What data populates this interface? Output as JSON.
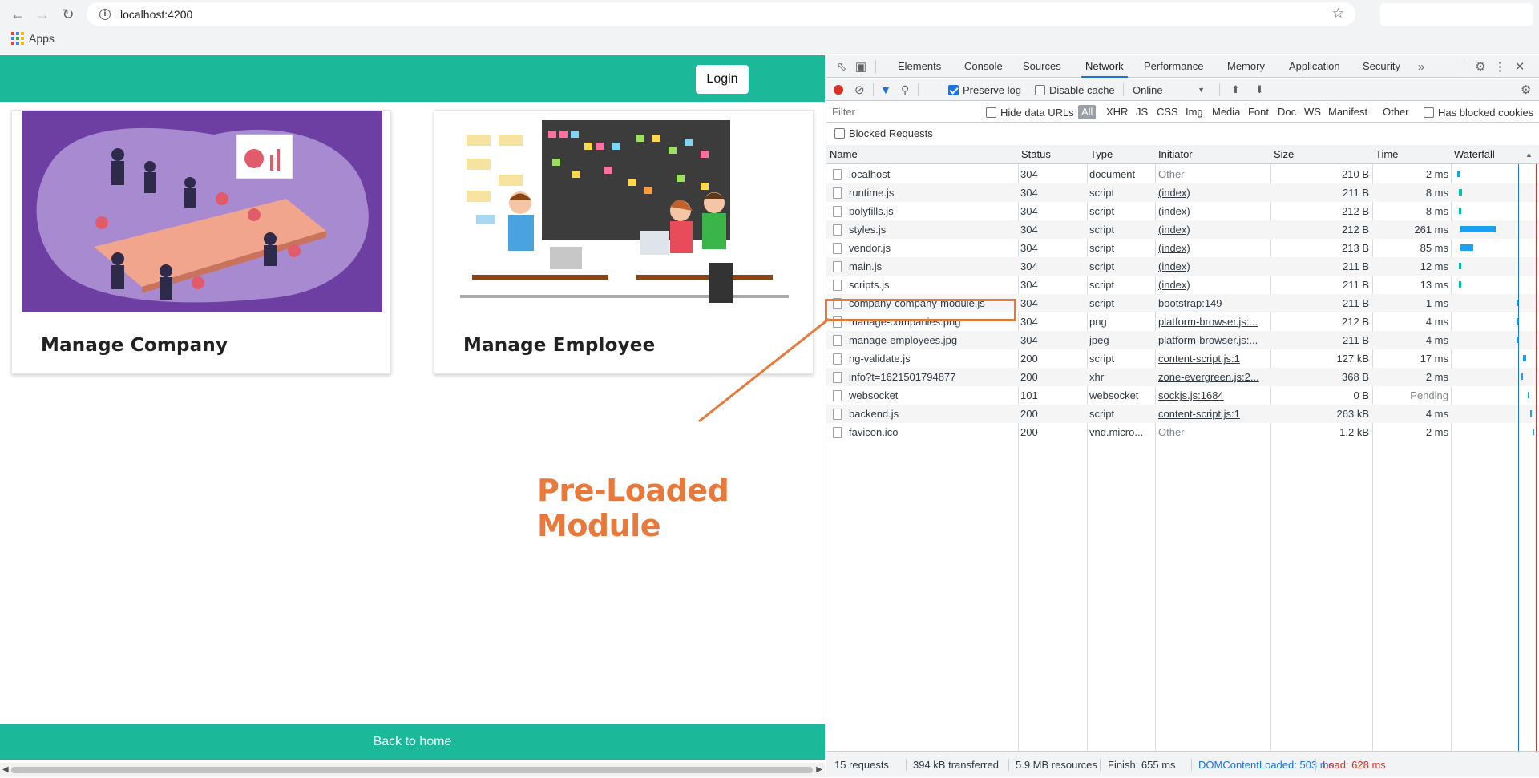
{
  "browser": {
    "url": "localhost:4200",
    "bookmark_apps": "Apps"
  },
  "app": {
    "login_label": "Login",
    "cards": [
      {
        "title": "Manage Company"
      },
      {
        "title": "Manage Employee"
      }
    ],
    "footer_label": "Back to home",
    "annotation": "Pre-Loaded Module",
    "colors": {
      "accent": "#1bb99a",
      "annotation": "#e8793b"
    }
  },
  "devtools": {
    "tabs": [
      "Elements",
      "Console",
      "Sources",
      "Network",
      "Performance",
      "Memory",
      "Application",
      "Security"
    ],
    "active_tab": "Network",
    "toolbar": {
      "preserve_log": "Preserve log",
      "disable_cache": "Disable cache",
      "throttle": "Online"
    },
    "filter": {
      "placeholder": "Filter",
      "hide_data_urls": "Hide data URLs",
      "types": [
        "All",
        "XHR",
        "JS",
        "CSS",
        "Img",
        "Media",
        "Font",
        "Doc",
        "WS",
        "Manifest",
        "Other"
      ],
      "has_blocked_cookies": "Has blocked cookies",
      "blocked_requests": "Blocked Requests"
    },
    "columns": [
      "Name",
      "Status",
      "Type",
      "Initiator",
      "Size",
      "Time",
      "Waterfall"
    ],
    "requests": [
      {
        "name": "localhost",
        "status": "304",
        "type": "document",
        "initiator": "Other",
        "init_link": false,
        "size": "210 B",
        "time": "2 ms"
      },
      {
        "name": "runtime.js",
        "status": "304",
        "type": "script",
        "initiator": "(index)",
        "init_link": true,
        "size": "211 B",
        "time": "8 ms"
      },
      {
        "name": "polyfills.js",
        "status": "304",
        "type": "script",
        "initiator": "(index)",
        "init_link": true,
        "size": "212 B",
        "time": "8 ms"
      },
      {
        "name": "styles.js",
        "status": "304",
        "type": "script",
        "initiator": "(index)",
        "init_link": true,
        "size": "212 B",
        "time": "261 ms"
      },
      {
        "name": "vendor.js",
        "status": "304",
        "type": "script",
        "initiator": "(index)",
        "init_link": true,
        "size": "213 B",
        "time": "85 ms"
      },
      {
        "name": "main.js",
        "status": "304",
        "type": "script",
        "initiator": "(index)",
        "init_link": true,
        "size": "211 B",
        "time": "12 ms"
      },
      {
        "name": "scripts.js",
        "status": "304",
        "type": "script",
        "initiator": "(index)",
        "init_link": true,
        "size": "211 B",
        "time": "13 ms"
      },
      {
        "name": "company-company-module.js",
        "status": "304",
        "type": "script",
        "initiator": "bootstrap:149",
        "init_link": true,
        "size": "211 B",
        "time": "1 ms"
      },
      {
        "name": "manage-companies.png",
        "status": "304",
        "type": "png",
        "initiator": "platform-browser.js:...",
        "init_link": true,
        "size": "212 B",
        "time": "4 ms"
      },
      {
        "name": "manage-employees.jpg",
        "status": "304",
        "type": "jpeg",
        "initiator": "platform-browser.js:...",
        "init_link": true,
        "size": "211 B",
        "time": "4 ms"
      },
      {
        "name": "ng-validate.js",
        "status": "200",
        "type": "script",
        "initiator": "content-script.js:1",
        "init_link": true,
        "size": "127 kB",
        "time": "17 ms"
      },
      {
        "name": "info?t=1621501794877",
        "status": "200",
        "type": "xhr",
        "initiator": "zone-evergreen.js:2...",
        "init_link": true,
        "size": "368 B",
        "time": "2 ms"
      },
      {
        "name": "websocket",
        "status": "101",
        "type": "websocket",
        "initiator": "sockjs.js:1684",
        "init_link": true,
        "size": "0 B",
        "time": "Pending"
      },
      {
        "name": "backend.js",
        "status": "200",
        "type": "script",
        "initiator": "content-script.js:1",
        "init_link": true,
        "size": "263 kB",
        "time": "4 ms"
      },
      {
        "name": "favicon.ico",
        "status": "200",
        "type": "vnd.micro...",
        "initiator": "Other",
        "init_link": false,
        "size": "1.2 kB",
        "time": "2 ms"
      }
    ],
    "status": {
      "requests": "15 requests",
      "transferred": "394 kB transferred",
      "resources": "5.9 MB resources",
      "finish": "Finish: 655 ms",
      "dcl": "DOMContentLoaded: 503 ms",
      "load": "Load: 628 ms"
    }
  }
}
